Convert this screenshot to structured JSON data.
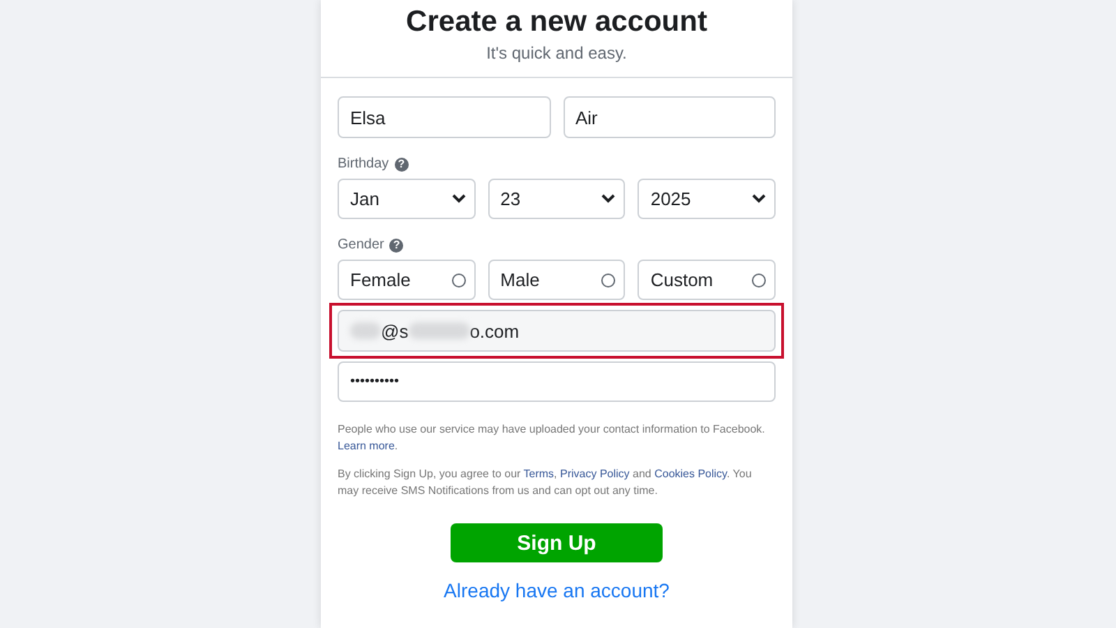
{
  "title": "Create a new account",
  "subtitle": "It's quick and easy.",
  "name_fields": [
    {
      "value": "Elsa"
    },
    {
      "value": "Air"
    }
  ],
  "birthday": {
    "label": "Birthday",
    "help": "?",
    "selects": [
      {
        "value": "Jan"
      },
      {
        "value": "23"
      },
      {
        "value": "2025"
      }
    ]
  },
  "gender": {
    "label": "Gender",
    "help": "?",
    "options": [
      {
        "label": "Female",
        "selected": false
      },
      {
        "label": "Male",
        "selected": false
      },
      {
        "label": "Custom",
        "selected": false
      }
    ]
  },
  "email": {
    "visible_parts": [
      "@s",
      "o.com"
    ],
    "highlighted": true
  },
  "password": {
    "value": "••••••••••"
  },
  "notice": {
    "text": "People who use our service may have uploaded your contact information to Facebook. ",
    "link": "Learn more",
    "end": "."
  },
  "terms": {
    "parts": [
      {
        "kind": "text",
        "text": "By clicking Sign Up, you agree to our "
      },
      {
        "kind": "link",
        "text": "Terms"
      },
      {
        "kind": "text",
        "text": ", "
      },
      {
        "kind": "link",
        "text": "Privacy Policy"
      },
      {
        "kind": "text",
        "text": " and "
      },
      {
        "kind": "link",
        "text": "Cookies Policy"
      },
      {
        "kind": "text",
        "text": ". You may receive SMS Notifications from us and can opt out any time."
      }
    ]
  },
  "signup_button": "Sign Up",
  "login_link": "Already have an account?"
}
